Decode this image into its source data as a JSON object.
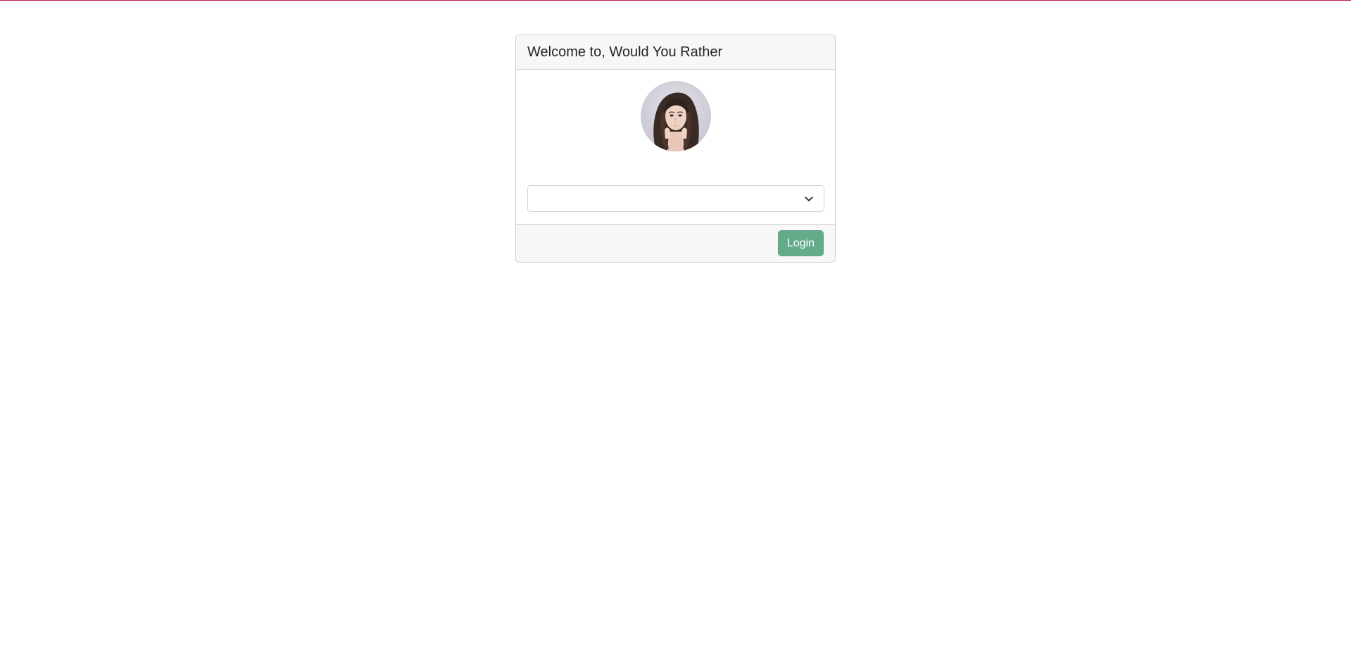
{
  "card": {
    "title": "Welcome to, Would You Rather"
  },
  "user_select": {
    "selected_value": "",
    "icon": "chevron-down-icon"
  },
  "avatar": {
    "icon": "user-avatar-photo"
  },
  "footer": {
    "login_label": "Login"
  },
  "colors": {
    "top_rule": "#c2185b",
    "login_button": "#64ab8b",
    "card_header_bg": "#f7f7f7"
  }
}
